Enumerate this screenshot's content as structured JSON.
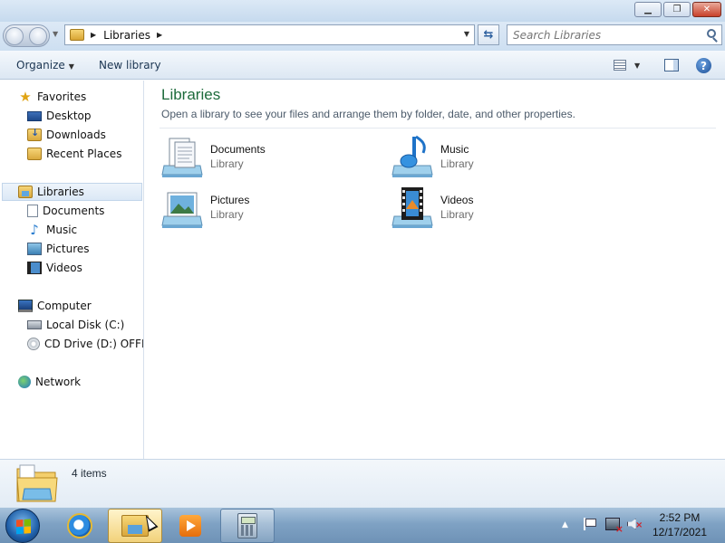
{
  "window": {
    "minimize_symbol": "▁",
    "restore_symbol": "❐",
    "close_symbol": "✕"
  },
  "navigation": {
    "address_path": "Libraries",
    "search_placeholder": "Search Libraries"
  },
  "toolbar": {
    "organize_label": "Organize",
    "new_library_label": "New library"
  },
  "sidebar": {
    "favorites": {
      "label": "Favorites",
      "items": [
        "Desktop",
        "Downloads",
        "Recent Places"
      ]
    },
    "libraries": {
      "label": "Libraries",
      "items": [
        "Documents",
        "Music",
        "Pictures",
        "Videos"
      ]
    },
    "computer": {
      "label": "Computer",
      "items": [
        "Local Disk (C:)",
        "CD Drive (D:) OFFICE"
      ]
    },
    "network": {
      "label": "Network"
    }
  },
  "main": {
    "title": "Libraries",
    "subtitle": "Open a library to see your files and arrange them by folder, date, and other properties.",
    "libraries": [
      {
        "name": "Documents",
        "type": "Library",
        "icon": "documents-library-icon"
      },
      {
        "name": "Music",
        "type": "Library",
        "icon": "music-library-icon"
      },
      {
        "name": "Pictures",
        "type": "Library",
        "icon": "pictures-library-icon"
      },
      {
        "name": "Videos",
        "type": "Library",
        "icon": "videos-library-icon"
      }
    ]
  },
  "details": {
    "item_count": "4 items"
  },
  "taskbar": {
    "pinned": [
      "internet-explorer-icon",
      "windows-explorer-icon",
      "media-player-icon",
      "calculator-icon"
    ],
    "active": "windows-explorer-icon",
    "clock_time": "2:52 PM",
    "clock_date": "12/17/2021"
  },
  "colors": {
    "title_green": "#1e6b3c",
    "taskbar": "#7fa2c4",
    "accent_blue": "#2c5f9e"
  }
}
